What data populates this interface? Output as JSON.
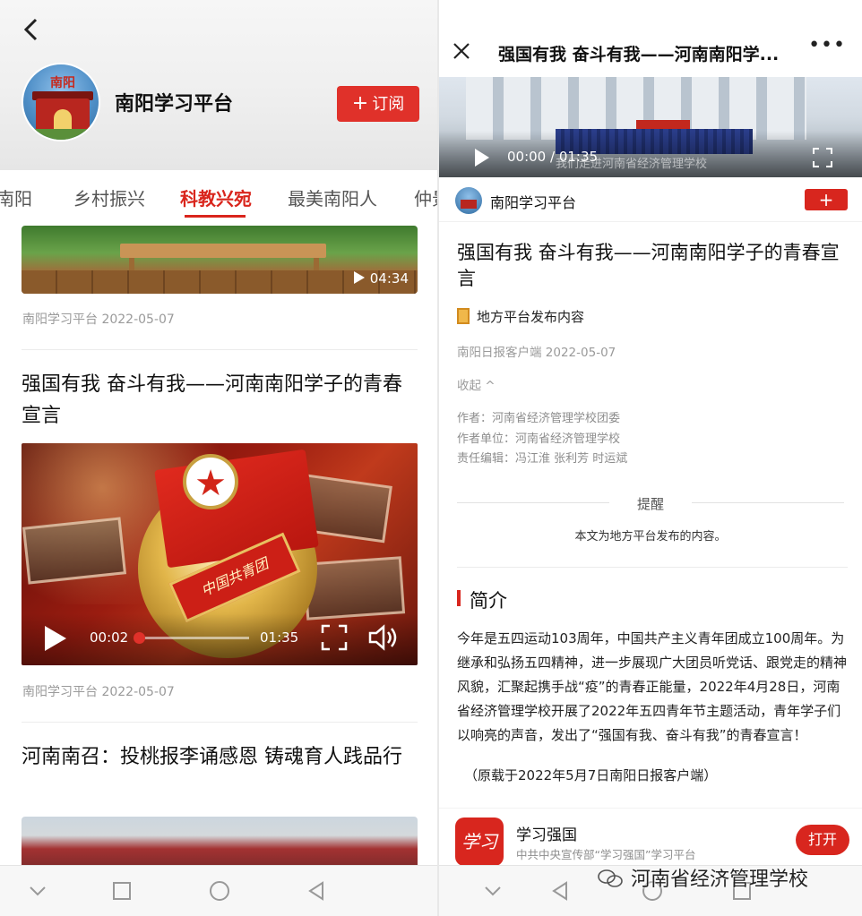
{
  "left": {
    "header": {
      "channel_name": "南阳学习平台",
      "subscribe_label": "订阅",
      "subscribe_plus": "+",
      "avatar_text": "南阳"
    },
    "tabs": [
      "南阳",
      "乡村振兴",
      "科教兴宛",
      "最美南阳人",
      "仲景"
    ],
    "active_tab": "科教兴宛",
    "feed": {
      "item0": {
        "duration": "04:34",
        "meta": "南阳学习平台  2022-05-07"
      },
      "item1": {
        "title": "强国有我 奋斗有我——河南南阳学子的青春宣言",
        "current_time": "00:02",
        "duration": "01:35",
        "band_text": "中国共青团",
        "progress": 0.02,
        "meta": "南阳学习平台  2022-05-07"
      },
      "item2": {
        "title": "河南南召：投桃报李诵感恩 铸魂育人践品行"
      }
    }
  },
  "right": {
    "topbar": {
      "title": "强国有我 奋斗有我——河南南阳学...",
      "more": "•••"
    },
    "video": {
      "time": "00:00 / 01:35",
      "watermark": "我们走进河南省经济管理学校"
    },
    "author_bar": {
      "name": "南阳学习平台",
      "plus": "+"
    },
    "article": {
      "title": "强国有我 奋斗有我——河南南阳学子的青春宣言",
      "badge": "地方平台发布内容",
      "source_meta": "南阳日报客户端  2022-05-07",
      "collapse": "收起 ^",
      "author": "作者：河南省经济管理学校团委",
      "author_unit": "作者单位：河南省经济管理学校",
      "editor": "责任编辑：冯江淮 张利芳 时运斌"
    },
    "notice": {
      "title": "提醒",
      "body": "本文为地方平台发布的内容。"
    },
    "intro": {
      "title": "简介",
      "body": "今年是五四运动103周年，中国共产主义青年团成立100周年。为继承和弘扬五四精神，进一步展现广大团员听党话、跟党走的精神风貌，汇聚起携手战“疫”的青春正能量，2022年4月28日，河南省经济管理学校开展了2022年五四青年节主题活动，青年学子们以响亮的声音，发出了“强国有我、奋斗有我”的青春宣言！",
      "source": "（原载于2022年5月7日南阳日报客户端）"
    },
    "footer": {
      "app_logo": "学习",
      "app_name": "学习强国",
      "app_desc": "中共中央宣传部“学习强国”学习平台",
      "open_label": "打开"
    },
    "watermark": "河南省经济管理学校"
  },
  "colors": {
    "accent": "#d8261e",
    "meta_gray": "#9a9a9a"
  }
}
